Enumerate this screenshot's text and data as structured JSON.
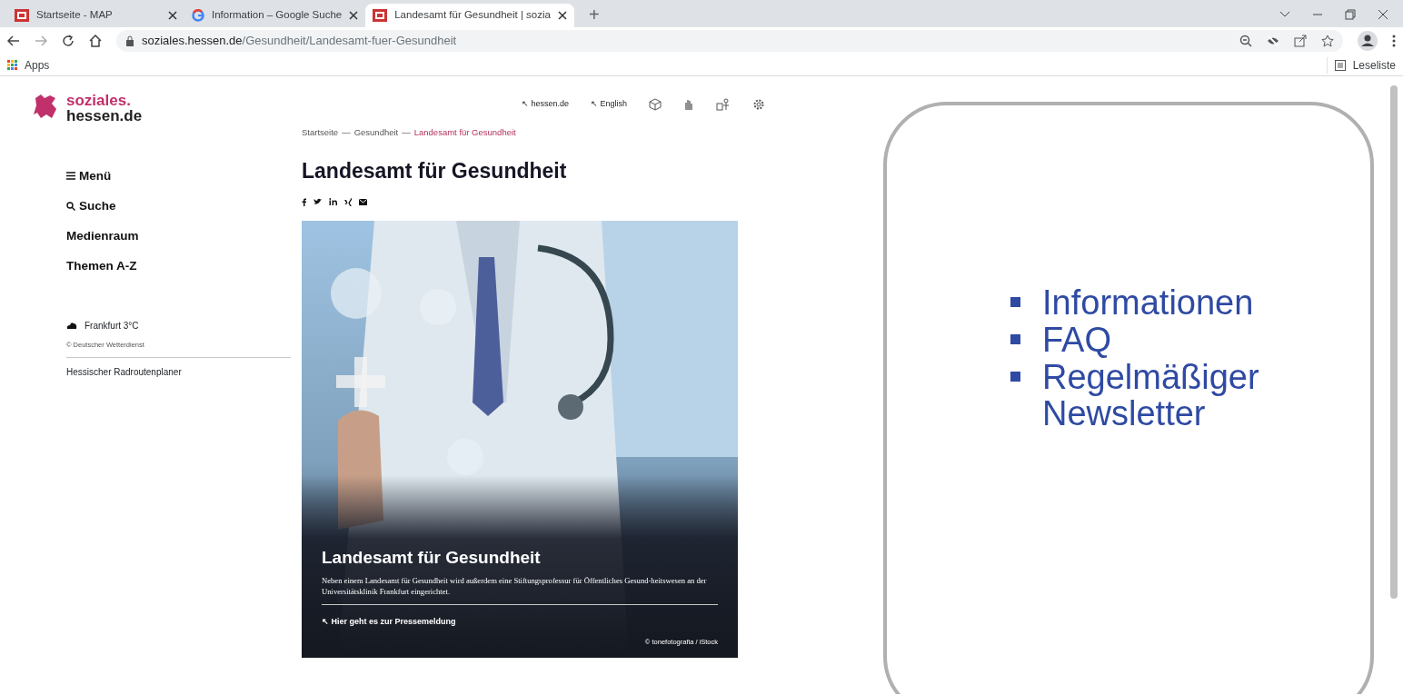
{
  "browser": {
    "tabs": [
      {
        "title": "Startseite - MAP",
        "selected": false
      },
      {
        "title": "Information – Google Suche",
        "selected": false
      },
      {
        "title": "Landesamt für Gesundheit | sozia",
        "selected": true
      }
    ],
    "new_tab": "+",
    "address": {
      "host": "soziales.hessen.de",
      "path": "/Gesundheit/Landesamt-fuer-Gesundheit"
    },
    "bookmarks": [
      {
        "label": "Apps"
      }
    ],
    "reading_list": "Leseliste"
  },
  "site": {
    "logo": {
      "line_1": "soziales.",
      "line_2": "hessen.de"
    },
    "top_links": [
      "↖ hessen.de",
      "↖ English"
    ],
    "breadcrumb": [
      {
        "label": "Startseite",
        "current": false,
        "separator": "—"
      },
      {
        "label": "Gesundheit",
        "current": false,
        "separator": "—"
      },
      {
        "label": "Landesamt für Gesundheit",
        "current": true
      }
    ],
    "menu": [
      {
        "label": "Menü"
      },
      {
        "label": "Suche"
      },
      {
        "label": "Medienraum"
      },
      {
        "label": "Themen A-Z"
      }
    ],
    "weather": {
      "text": "Frankfurt 3°C",
      "source": "© Deutscher Wetterdienst"
    },
    "sidebar_link": "Hessischer Radroutenplaner",
    "title": "Landesamt für Gesundheit",
    "hero": {
      "kind": "picture",
      "title": "Landesamt für Gesundheit",
      "text": "Neben einem Landesamt für Gesundheit wird außerdem eine Stiftungsprofessur für Öffentliches Gesund-heitswesen an der Universitätsklinik Frankfurt eingerichtet.",
      "link": "↖ Hier geht es zur Pressemeldung",
      "credit": "© tonefotografia / iStock"
    }
  },
  "callout": {
    "items": [
      "Informationen",
      "FAQ",
      "Regelmäßiger Newsletter"
    ]
  }
}
